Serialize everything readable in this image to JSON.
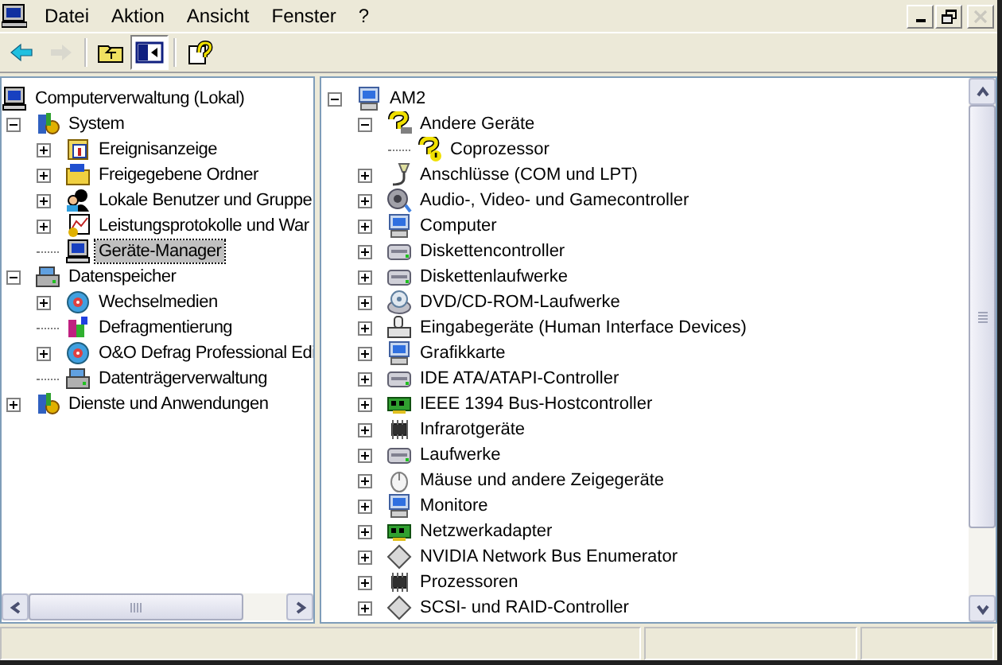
{
  "window_controls": [
    {
      "kind": "minimize",
      "disabled": false
    },
    {
      "kind": "restore",
      "disabled": false
    },
    {
      "kind": "close",
      "disabled": true
    }
  ],
  "menu": [
    "Datei",
    "Aktion",
    "Ansicht",
    "Fenster",
    "?"
  ],
  "toolbar": [
    {
      "kind": "back",
      "disabled": false,
      "pressed": false
    },
    {
      "kind": "forward",
      "disabled": true,
      "pressed": false
    },
    {
      "kind": "up",
      "disabled": false,
      "pressed": false
    },
    {
      "kind": "tree",
      "disabled": false,
      "pressed": true
    },
    {
      "kind": "help",
      "disabled": false,
      "pressed": false
    }
  ],
  "console_tree": [
    {
      "label": "Computerverwaltung (Lokal)",
      "selected": false,
      "children": [
        {
          "label": "System",
          "expanded": true,
          "selected": false,
          "children": [
            {
              "label": "Ereignisanzeige",
              "expanded": false,
              "selected": false
            },
            {
              "label": "Freigegebene Ordner",
              "expanded": false,
              "selected": false
            },
            {
              "label": "Lokale Benutzer und Gruppe",
              "expanded": false,
              "selected": false
            },
            {
              "label": "Leistungsprotokolle und War",
              "expanded": false,
              "selected": false
            },
            {
              "label": "Geräte-Manager",
              "selected": true
            }
          ]
        },
        {
          "label": "Datenspeicher",
          "expanded": true,
          "selected": false,
          "children": [
            {
              "label": "Wechselmedien",
              "expanded": false,
              "selected": false
            },
            {
              "label": "Defragmentierung",
              "selected": false
            },
            {
              "label": "O&O Defrag Professional Edi",
              "expanded": false,
              "selected": false
            },
            {
              "label": "Datenträgerverwaltung",
              "selected": false
            }
          ]
        },
        {
          "label": "Dienste und Anwendungen",
          "expanded": false,
          "selected": false
        }
      ]
    }
  ],
  "device_tree": [
    {
      "label": "AM2",
      "expanded": true,
      "selected": false,
      "children": [
        {
          "label": "Andere Geräte",
          "expanded": true,
          "selected": false,
          "children": [
            {
              "label": "Coprozessor",
              "selected": false
            }
          ]
        },
        {
          "label": "Anschlüsse (COM und LPT)",
          "expanded": false,
          "selected": false
        },
        {
          "label": "Audio-, Video- und Gamecontroller",
          "expanded": false,
          "selected": false
        },
        {
          "label": "Computer",
          "expanded": false,
          "selected": false
        },
        {
          "label": "Diskettencontroller",
          "expanded": false,
          "selected": false
        },
        {
          "label": "Diskettenlaufwerke",
          "expanded": false,
          "selected": false
        },
        {
          "label": "DVD/CD-ROM-Laufwerke",
          "expanded": false,
          "selected": false
        },
        {
          "label": "Eingabegeräte (Human Interface Devices)",
          "expanded": false,
          "selected": false
        },
        {
          "label": "Grafikkarte",
          "expanded": false,
          "selected": false
        },
        {
          "label": "IDE ATA/ATAPI-Controller",
          "expanded": false,
          "selected": false
        },
        {
          "label": "IEEE 1394 Bus-Hostcontroller",
          "expanded": false,
          "selected": false
        },
        {
          "label": "Infrarotgeräte",
          "expanded": false,
          "selected": false
        },
        {
          "label": "Laufwerke",
          "expanded": false,
          "selected": false
        },
        {
          "label": "Mäuse und andere Zeigegeräte",
          "expanded": false,
          "selected": false
        },
        {
          "label": "Monitore",
          "expanded": false,
          "selected": false
        },
        {
          "label": "Netzwerkadapter",
          "expanded": false,
          "selected": false
        },
        {
          "label": "NVIDIA Network Bus Enumerator",
          "expanded": false,
          "selected": false
        },
        {
          "label": "Prozessoren",
          "expanded": false,
          "selected": false
        },
        {
          "label": "SCSI- und RAID-Controller",
          "expanded": false,
          "selected": false
        }
      ]
    }
  ]
}
